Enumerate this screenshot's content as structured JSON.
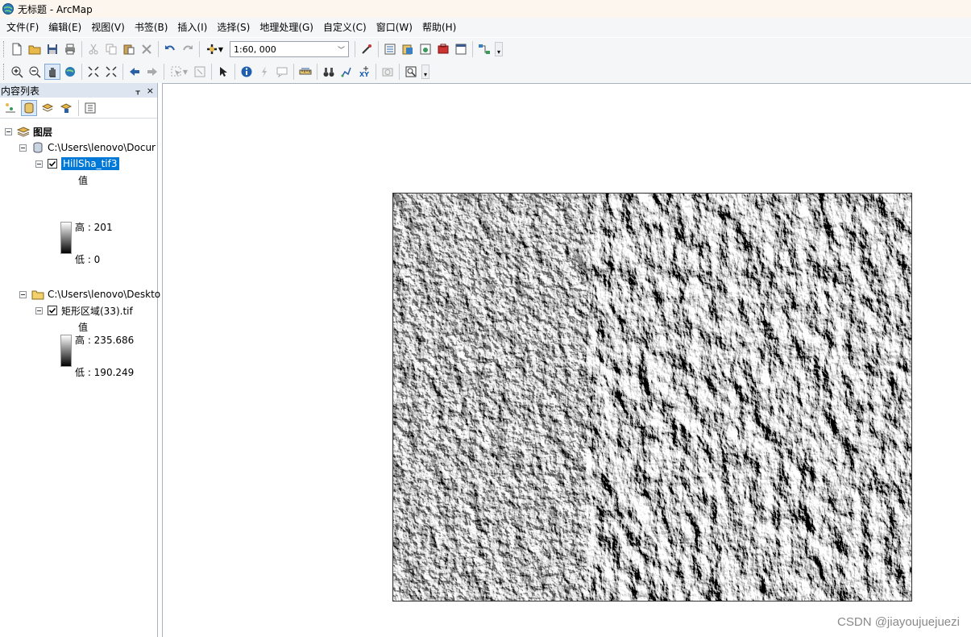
{
  "window": {
    "title": "无标题 - ArcMap"
  },
  "menu": [
    "文件(F)",
    "编辑(E)",
    "视图(V)",
    "书签(B)",
    "插入(I)",
    "选择(S)",
    "地理处理(G)",
    "自定义(C)",
    "窗口(W)",
    "帮助(H)"
  ],
  "toolbar": {
    "scale_value": "1:60, 000"
  },
  "toc": {
    "title": "内容列表",
    "pin_glyph": "ᚁ",
    "close_glyph": "×",
    "root_label": "图层",
    "groups": [
      {
        "path": "C:\\Users\\lenovo\\Docur",
        "layer_name": "HillSha_tif3",
        "selected": true,
        "value_label": "值",
        "high_label": "高 : 201",
        "low_label": "低 : 0"
      },
      {
        "path": "C:\\Users\\lenovo\\Deskto",
        "layer_name": "矩形区域(33).tif",
        "selected": false,
        "value_label": "值",
        "high_label": "高 : 235.686",
        "low_label": "低 : 190.249"
      }
    ]
  },
  "watermark": "CSDN @jiayoujuejuezi",
  "colors": {
    "selection": "#0078d7",
    "panel_header": "#dde6f0",
    "chrome": "#f4f6f8"
  }
}
